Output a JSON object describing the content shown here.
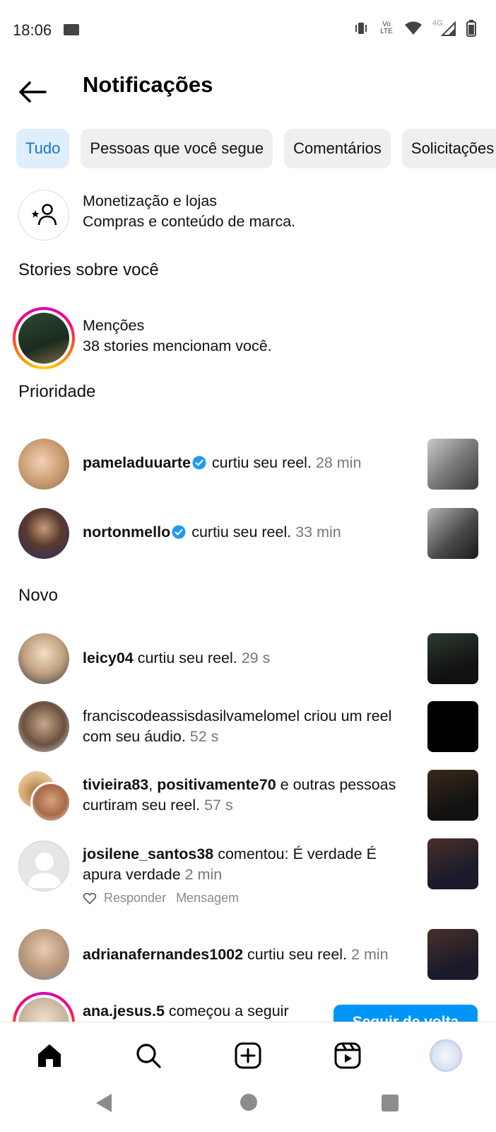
{
  "status_bar": {
    "time": "18:06",
    "volte": "Vo LTE",
    "network": "4G"
  },
  "header": {
    "title": "Notificações"
  },
  "chips": [
    "Tudo",
    "Pessoas que você segue",
    "Comentários",
    "Solicitações"
  ],
  "monetization": {
    "title": "Monetização e lojas",
    "subtitle": "Compras e conteúdo de marca."
  },
  "sections": {
    "stories": "Stories sobre você",
    "priority": "Prioridade",
    "new": "Novo"
  },
  "mentions": {
    "title": "Menções",
    "subtitle": "38 stories mencionam você."
  },
  "priority_items": [
    {
      "user": "pameladuuarte",
      "action": "curtiu seu reel.",
      "time": "28 min"
    },
    {
      "user": "nortonmello",
      "action": "curtiu seu reel.",
      "time": "33 min"
    }
  ],
  "new_items": [
    {
      "user": "leicy04",
      "action": "curtiu seu reel.",
      "time": "29 s"
    },
    {
      "user": "franciscodeassisdasilvamelomel",
      "action": "criou um reel com seu áudio.",
      "time": "52 s"
    },
    {
      "user": "tivieira83",
      "user2": "positivamente70",
      "action": "e outras pessoas curtiram seu reel.",
      "time": "57 s"
    },
    {
      "user": "josilene_santos38",
      "action": "comentou: É verdade  É apura verdade",
      "time": "2 min",
      "reply": "Responder",
      "message": "Mensagem"
    },
    {
      "user": "adrianafernandes1002",
      "action": "curtiu seu reel.",
      "time": "2 min"
    },
    {
      "user": "ana.jesus.5",
      "action": "começou a seguir",
      "button": "Seguir de volta"
    }
  ],
  "colors": {
    "accent": "#0095f6",
    "verified": "#1d9bf0",
    "chip_active_bg": "#dfeefb",
    "chip_active_text": "#1d72c5"
  }
}
